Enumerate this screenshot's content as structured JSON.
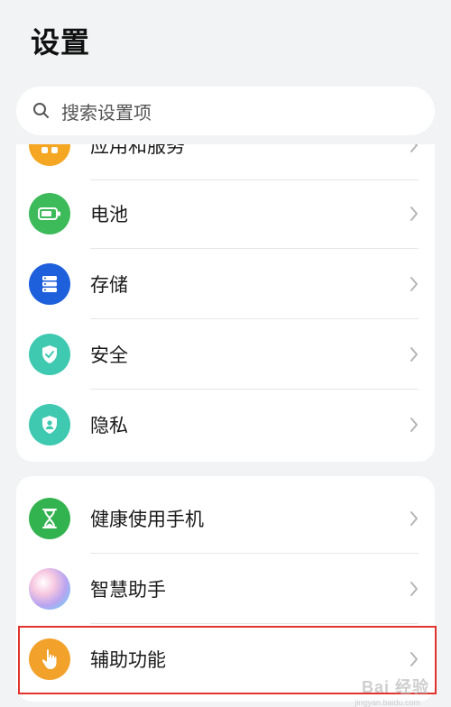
{
  "header": {
    "title": "设置"
  },
  "search": {
    "placeholder": "搜索设置项"
  },
  "group1": {
    "items": [
      {
        "label": "应用和服务",
        "icon": "apps-icon",
        "color": "#f5a623"
      },
      {
        "label": "电池",
        "icon": "battery-icon",
        "color": "#3dbb5a"
      },
      {
        "label": "存储",
        "icon": "storage-icon",
        "color": "#1e5fdc"
      },
      {
        "label": "安全",
        "icon": "shield-check-icon",
        "color": "#3ec9b0"
      },
      {
        "label": "隐私",
        "icon": "privacy-shield-icon",
        "color": "#3ec9b0"
      }
    ]
  },
  "group2": {
    "items": [
      {
        "label": "健康使用手机",
        "icon": "hourglass-icon",
        "color": "#33b34f"
      },
      {
        "label": "智慧助手",
        "icon": "assistant-orb-icon",
        "color": "#c49be8"
      },
      {
        "label": "辅助功能",
        "icon": "hand-pointer-icon",
        "color": "#f2a12b"
      }
    ]
  },
  "watermark": {
    "text": "Bai 经验",
    "sub": "jingyan.baidu.com"
  },
  "colors": {
    "background": "#f1f3f5",
    "card": "#ffffff",
    "highlight": "#e0332e"
  }
}
